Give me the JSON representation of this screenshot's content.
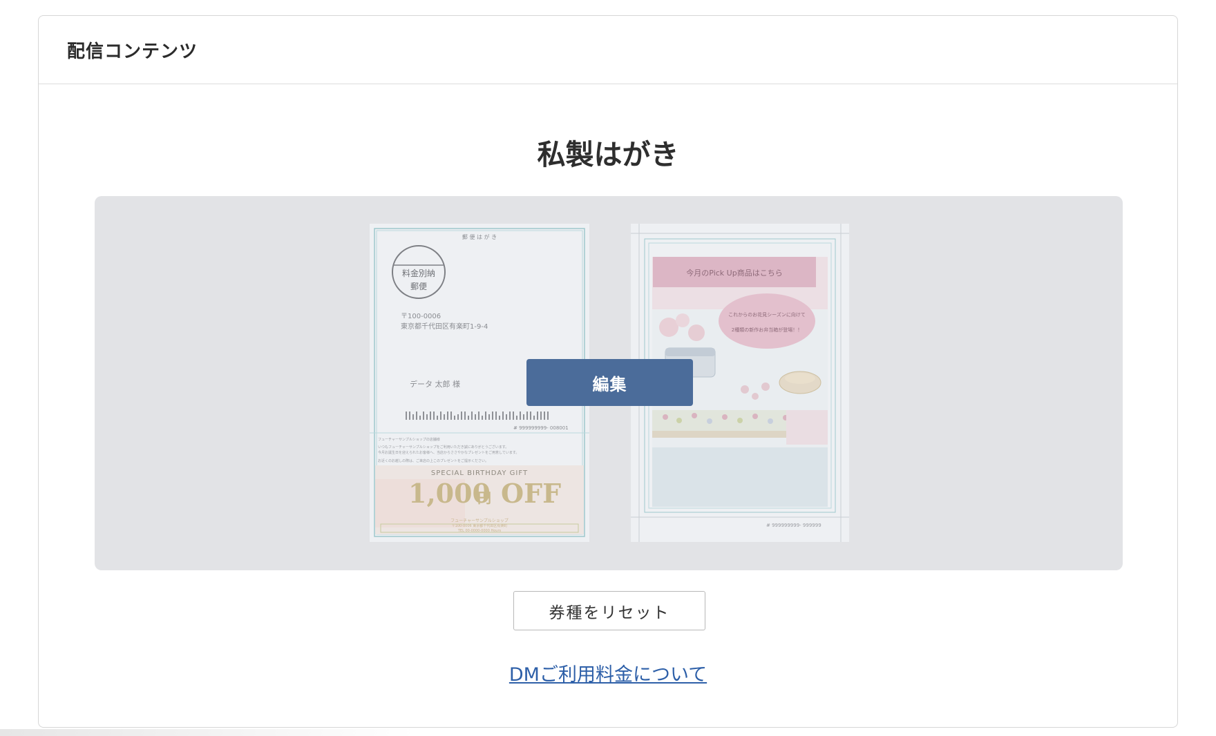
{
  "header": {
    "title": "配信コンテンツ"
  },
  "main": {
    "title": "私製はがき",
    "edit_label": "編集",
    "reset_label": "券種をリセット",
    "fee_link_label": "DMご利用料金について"
  },
  "front": {
    "top_label": "郵 便 は が き",
    "stamp_line1": "料金別納",
    "stamp_line2": "郵便",
    "zip": "〒100-0006",
    "address": "東京都千代田区有楽町1-9-4",
    "recipient": "データ 太郎 様",
    "serial": "# 999999999- 008001",
    "shop_name": "フューチャーサンプルショップの店舗様",
    "greeting_1": "いつもフューチャーサンプルショップをご利用いただき誠にありがとうございます。",
    "greeting_2": "今月お誕生日を迎えられたお客様へ、当店からささやかなプレゼントをご用意しています。",
    "greeting_3": "お近くのお越しの際は、ご来店の上このプレゼントをご提示ください。",
    "gift_label": "SPECIAL BIRTHDAY GIFT",
    "gift_amount": "1,000",
    "gift_unit": "円",
    "gift_off": "OFF",
    "footer_shop": "フューチャーサンプルショップ",
    "footer_addr": "〒100-0006 東京都千代田区有楽町",
    "footer_tel": "TEL 00-0000-0000 Hours"
  },
  "back": {
    "banner": "今月のPick Up商品はこちら",
    "bubble_line1": "これからのお花見シーズンに向けて",
    "bubble_line2": "2種類の新作お弁当箱が登場！！",
    "serial": "# 999999999- 999999"
  },
  "colors": {
    "accent": "#4b6c9a",
    "link": "#2d5fa8",
    "preview_bg": "#e2e3e6",
    "banner_pink": "#dcb6c5",
    "bubble_pink": "#e3c0cd"
  }
}
